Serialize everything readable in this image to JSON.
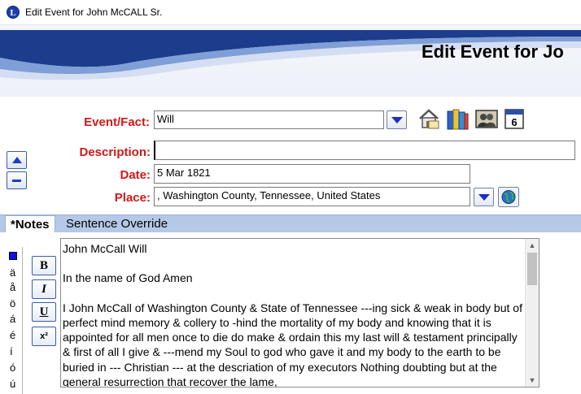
{
  "window": {
    "title": "Edit Event for John McCALL Sr.",
    "app_icon_letter": "L"
  },
  "header": {
    "title": "Edit Event for Jo"
  },
  "form": {
    "event_fact": {
      "label": "Event/Fact:",
      "value": "Will"
    },
    "description": {
      "label": "Description:",
      "value": ""
    },
    "date": {
      "label": "Date:",
      "value": "5 Mar 1821"
    },
    "place": {
      "label": "Place:",
      "value": ", Washington County, Tennessee, United States"
    }
  },
  "toolbar_icons": [
    "home-map-icon",
    "books-icon",
    "people-portrait-icon",
    "calendar-icon"
  ],
  "calendar_day": "6",
  "tabs": [
    {
      "label": "*Notes",
      "active": true
    },
    {
      "label": "Sentence Override",
      "active": false
    }
  ],
  "special_chars": [
    "ä",
    "å",
    "ö",
    "á",
    "é",
    "í",
    "ó",
    "ú"
  ],
  "format_buttons": {
    "bold": "B",
    "italic": "I",
    "underline": "U",
    "superscript": "x²"
  },
  "notes": {
    "text": "John McCall Will\n\nIn the name of God Amen\n\nI John McCall of Washington County & State of Tennessee ---ing sick & weak in body but of perfect mind memory & collery to -hind the mortality of my body and knowing that it is appointed for all men once to die do make & ordain this my last will & testament principally & first of all I give & ---mend my Soul to god who gave it and my body to the earth to be buried in --- Christian --- at the descriation of my executors Nothing doubting but at the general resurrection that recover the lame,"
  },
  "colors": {
    "label_red": "#d01818",
    "tab_bar": "#b5c9e6",
    "accent_blue": "#1a3fc4"
  }
}
